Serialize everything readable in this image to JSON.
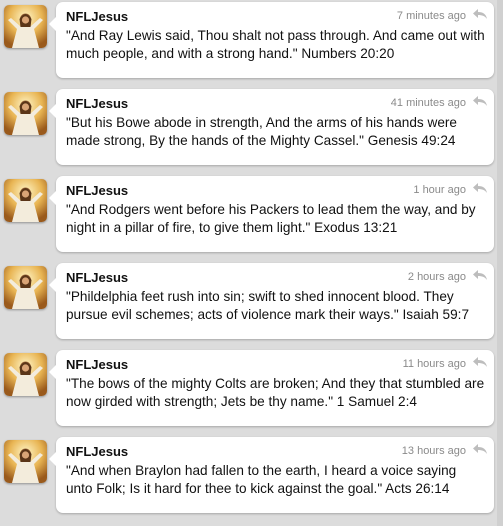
{
  "colors": {
    "background": "#dcdcdc",
    "bubble": "#ffffff",
    "timestamp": "#8a8a8a",
    "text": "#111111"
  },
  "icons": {
    "avatar": "jesus-avatar-icon",
    "reply": "reply-arrow-icon"
  },
  "tweets": [
    {
      "username": "NFLJesus",
      "time": "7 minutes ago",
      "text": "\"And Ray Lewis said, Thou shalt not pass through. And came out with much people, and with a strong hand.\" Numbers 20:20"
    },
    {
      "username": "NFLJesus",
      "time": "41 minutes ago",
      "text": "\"But his Bowe abode in strength, And the arms of his hands were made strong, By the hands of the Mighty Cassel.\" Genesis 49:24"
    },
    {
      "username": "NFLJesus",
      "time": "1 hour ago",
      "text": "\"And Rodgers went before his Packers to lead them the way, and by night in a pillar of fire, to give them light.\" Exodus 13:21"
    },
    {
      "username": "NFLJesus",
      "time": "2 hours ago",
      "text": "\"Phildelphia feet rush into sin; swift to shed innocent blood. They pursue evil schemes; acts of violence mark their ways.\" Isaiah 59:7"
    },
    {
      "username": "NFLJesus",
      "time": "11 hours ago",
      "text": "\"The bows of the mighty Colts are broken; And they that stumbled are now girded with strength; Jets be thy name.\" 1 Samuel 2:4"
    },
    {
      "username": "NFLJesus",
      "time": "13 hours ago",
      "text": "\"And when Braylon had fallen to the earth, I heard a voice saying unto Folk; Is it hard for thee to kick against the goal.\" Acts 26:14"
    }
  ]
}
